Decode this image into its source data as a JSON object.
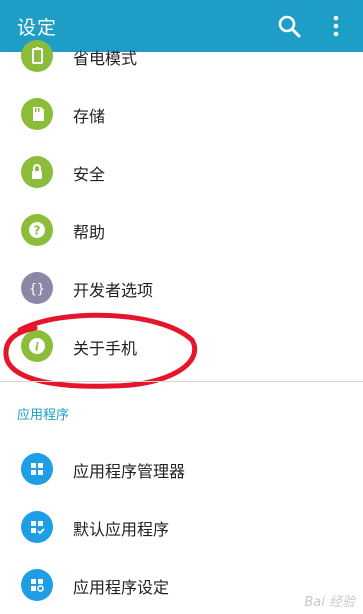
{
  "header": {
    "title": "设定",
    "search_icon": "search-icon",
    "more_icon": "more-vertical-icon"
  },
  "items": [
    {
      "label": "省电模式",
      "icon": "battery-icon",
      "color": "#8cbd3a"
    },
    {
      "label": "存储",
      "icon": "sd-card-icon",
      "color": "#8cbd3a"
    },
    {
      "label": "安全",
      "icon": "lock-icon",
      "color": "#8cbd3a"
    },
    {
      "label": "帮助",
      "icon": "help-icon",
      "color": "#8cbd3a"
    },
    {
      "label": "开发者选项",
      "icon": "code-braces-icon",
      "color": "#8d87a6"
    },
    {
      "label": "关于手机",
      "icon": "info-icon",
      "color": "#8cbd3a"
    }
  ],
  "section_title": "应用程序",
  "apps": [
    {
      "label": "应用程序管理器",
      "icon": "app-grid-icon",
      "color": "#1e9ee4"
    },
    {
      "label": "默认应用程序",
      "icon": "app-check-icon",
      "color": "#1e9ee4"
    },
    {
      "label": "应用程序设定",
      "icon": "app-gear-icon",
      "color": "#1e9ee4"
    }
  ],
  "watermark": "Bai 经验"
}
